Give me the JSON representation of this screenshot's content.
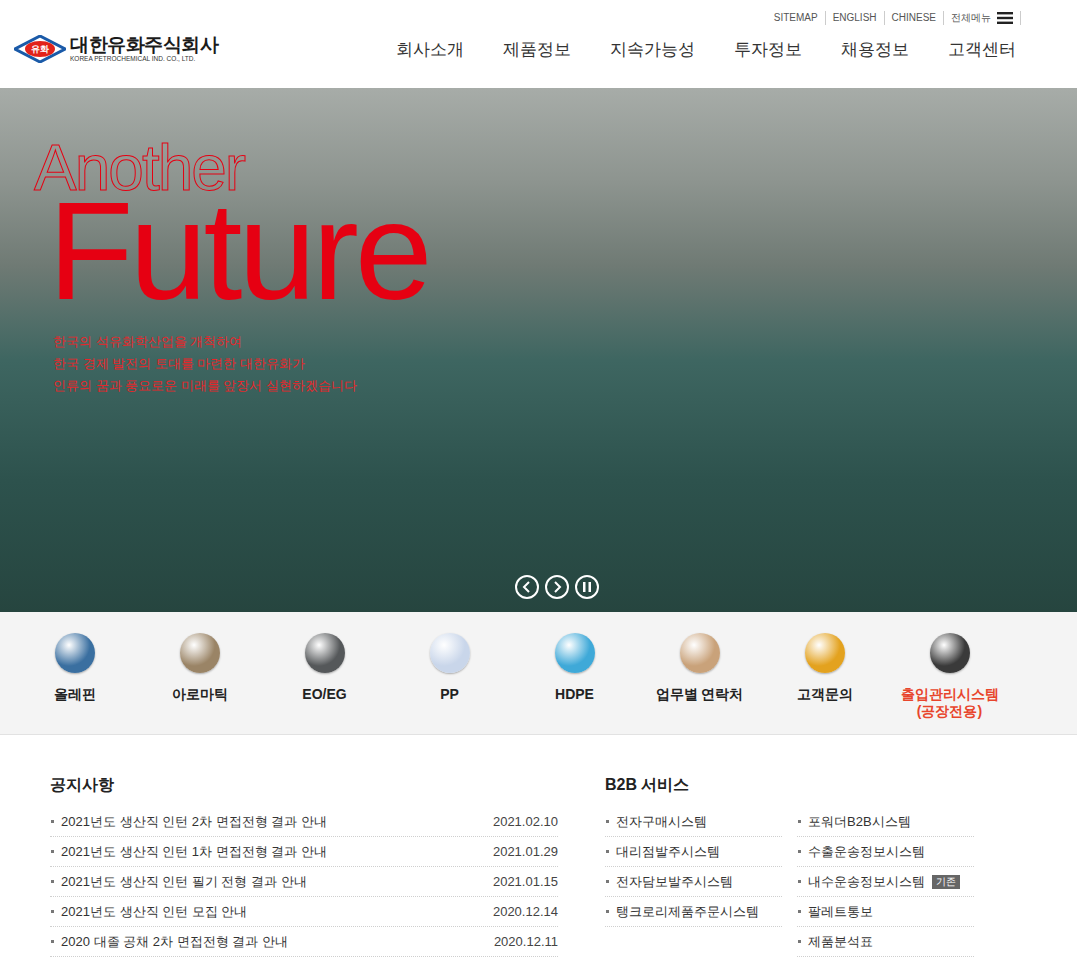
{
  "utility_links": [
    "SITEMAP",
    "ENGLISH",
    "CHINESE",
    "전체메뉴"
  ],
  "logo": {
    "badge": "유화",
    "name": "대한유화주식회사",
    "english": "KOREA PETROCHEMICAL IND. CO., LTD."
  },
  "nav": [
    "회사소개",
    "제품정보",
    "지속가능성",
    "투자정보",
    "채용정보",
    "고객센터"
  ],
  "hero": {
    "title_small": "Another",
    "title_large": "Future",
    "lines": [
      "한국의 석유화학산업을 개척하여",
      "한국 경제 발전의 토대를 마련한 대한유화가",
      "인류의 꿈과 풍요로운 미래를 앞장서 실현하겠습니다"
    ],
    "playing": true
  },
  "quick_links": [
    {
      "label": "올레핀",
      "highlight": false,
      "color": "#3a6fa0"
    },
    {
      "label": "아로마틱",
      "highlight": false,
      "color": "#9a8466"
    },
    {
      "label": "EO/EG",
      "highlight": false,
      "color": "#55585a"
    },
    {
      "label": "PP",
      "highlight": false,
      "color": "#c9d6ea"
    },
    {
      "label": "HDPE",
      "highlight": false,
      "color": "#3fa9d8"
    },
    {
      "label": "업무별 연락처",
      "highlight": false,
      "color": "#c9a27a"
    },
    {
      "label": "고객문의",
      "highlight": false,
      "color": "#e3a21f"
    },
    {
      "label": "출입관리시스템\n(공장전용)",
      "highlight": true,
      "color": "#3a3a3a"
    }
  ],
  "notices": {
    "title": "공지사항",
    "items": [
      {
        "title": "2021년도 생산직 인턴 2차 면접전형 결과 안내",
        "date": "2021.02.10"
      },
      {
        "title": "2021년도 생산직 인턴 1차 면접전형 결과 안내",
        "date": "2021.01.29"
      },
      {
        "title": "2021년도 생산직 인턴 필기 전형 결과 안내",
        "date": "2021.01.15"
      },
      {
        "title": "2021년도 생산직 인턴 모집 안내",
        "date": "2020.12.14"
      },
      {
        "title": "2020 대졸 공채 2차 면접전형 결과 안내",
        "date": "2020.12.11"
      }
    ]
  },
  "b2b": {
    "title": "B2B 서비스",
    "columns": [
      [
        {
          "label": "전자구매시스템",
          "badge": ""
        },
        {
          "label": "대리점발주시스템",
          "badge": ""
        },
        {
          "label": "전자담보발주시스템",
          "badge": ""
        },
        {
          "label": "탱크로리제품주문시스템",
          "badge": ""
        }
      ],
      [
        {
          "label": "포워더B2B시스템",
          "badge": ""
        },
        {
          "label": "수출운송정보시스템",
          "badge": ""
        },
        {
          "label": "내수운송정보시스템",
          "badge": "기존"
        },
        {
          "label": "팔레트통보",
          "badge": ""
        },
        {
          "label": "제품분석표",
          "badge": ""
        }
      ]
    ]
  }
}
